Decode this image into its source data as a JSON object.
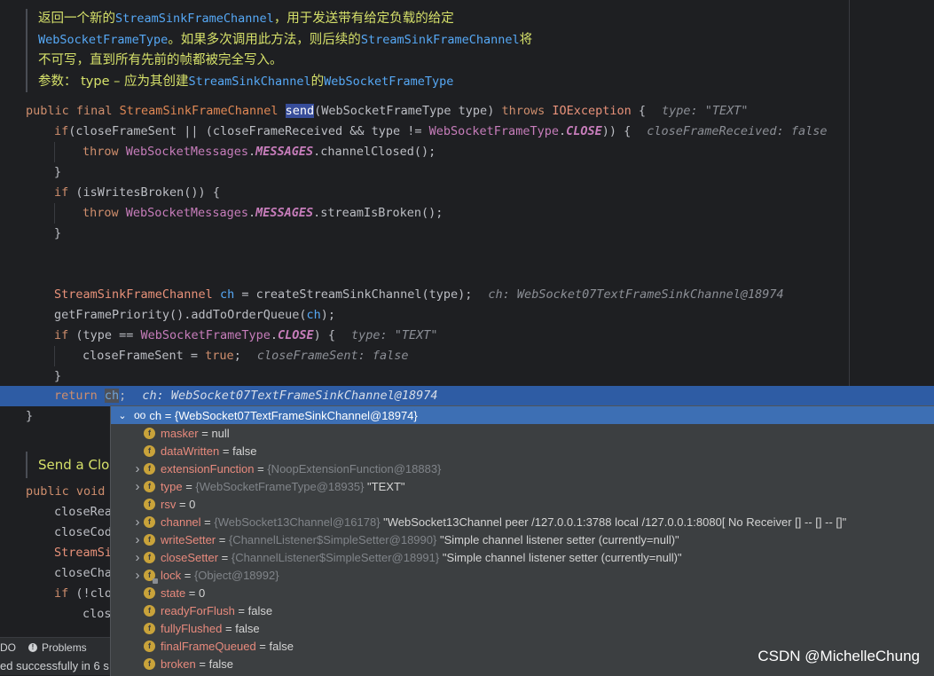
{
  "doc": {
    "l1_a": "返回一个新的",
    "l1_code": "StreamSinkFrameChannel",
    "l1_b": "，用于发送带有给定负载的给定",
    "l2_code": "WebSocketFrameType",
    "l2_a": "。如果多次调用此方法，则后续的",
    "l2_code2": "StreamSinkFrameChannel",
    "l2_b": "将",
    "l3": "不可写，直到所有先前的帧都被完全写入。",
    "l4_a": "参数：  type – 应为其创建",
    "l4_code": "StreamSinkChannel",
    "l4_b": "的",
    "l4_code2": "WebSocketFrameType"
  },
  "code": {
    "sig_public": "public final ",
    "sig_type": "StreamSinkFrameChannel ",
    "sig_name": "send",
    "sig_params": "(WebSocketFrameType type) ",
    "sig_throws": "throws ",
    "sig_exc": "IOException",
    "sig_brace": " {",
    "sig_hint": "type: \"TEXT\"",
    "if1_a": "if",
    "if1_b": "(closeFrameSent || (closeFrameReceived && type != ",
    "if1_enum": "WebSocketFrameType",
    "if1_dot": ".",
    "if1_const": "CLOSE",
    "if1_c": ")) {",
    "if1_hint": "closeFrameReceived: false",
    "throw1_kw": "throw ",
    "throw1_cls": "WebSocketMessages",
    "throw1_dot": ".",
    "throw1_const": "MESSAGES",
    "throw1_call": ".channelClosed();",
    "brace": "}",
    "if2_kw": "if ",
    "if2_rest": "(isWritesBroken()) {",
    "throw2_kw": "throw ",
    "throw2_cls": "WebSocketMessages",
    "throw2_dot": ".",
    "throw2_const": "MESSAGES",
    "throw2_call": ".streamIsBroken();",
    "decl_type": "StreamSinkFrameChannel ",
    "decl_var": "ch",
    "decl_rest": " = createStreamSinkChannel(type);",
    "decl_hint": "ch: WebSocket07TextFrameSinkChannel@18974",
    "prio_a": "getFramePriority().addToOrderQueue(",
    "prio_var": "ch",
    "prio_b": ");",
    "if3_kw": "if ",
    "if3_a": "(type == ",
    "if3_enum": "WebSocketFrameType",
    "if3_dot": ".",
    "if3_const": "CLOSE",
    "if3_b": ") {",
    "if3_hint": "type: \"TEXT\"",
    "close_a": "closeFrameSent = ",
    "close_true": "true",
    "close_b": ";",
    "close_hint": "closeFrameSent: false",
    "ret_kw": "return ",
    "ret_var": "ch",
    "ret_semi": ";",
    "ret_hint": "ch: WebSocket07TextFrameSinkChannel@18974",
    "end_brace": "}",
    "doc2": "Send a Clo",
    "pv_public": "public void",
    "pv_rest": "",
    "s1": "closeRea",
    "s2": "closeCod",
    "s3": "StreamSi",
    "s4": "closeCha",
    "s5_kw": "if",
    "s5_rest": " (!clo",
    "s6": "clos"
  },
  "popup": {
    "root_icon": "oo",
    "root_label": "ch = {WebSocket07TextFrameSinkChannel@18974}",
    "fields": [
      {
        "name": "masker",
        "ref": "",
        "value": "null",
        "expandable": false,
        "locked": false
      },
      {
        "name": "dataWritten",
        "ref": "",
        "value": "false",
        "expandable": false,
        "locked": false
      },
      {
        "name": "extensionFunction",
        "ref": "{NoopExtensionFunction@18883}",
        "value": "",
        "expandable": true,
        "locked": false
      },
      {
        "name": "type",
        "ref": "{WebSocketFrameType@18935}",
        "value": "\"TEXT\"",
        "expandable": true,
        "locked": false
      },
      {
        "name": "rsv",
        "ref": "",
        "value": "0",
        "expandable": false,
        "locked": false
      },
      {
        "name": "channel",
        "ref": "{WebSocket13Channel@16178}",
        "value": "\"WebSocket13Channel peer /127.0.0.1:3788 local /127.0.0.1:8080[ No Receiver [] -- [] -- []\"",
        "expandable": true,
        "locked": false
      },
      {
        "name": "writeSetter",
        "ref": "{ChannelListener$SimpleSetter@18990}",
        "value": "\"Simple channel listener setter (currently=null)\"",
        "expandable": true,
        "locked": false
      },
      {
        "name": "closeSetter",
        "ref": "{ChannelListener$SimpleSetter@18991}",
        "value": "\"Simple channel listener setter (currently=null)\"",
        "expandable": true,
        "locked": false
      },
      {
        "name": "lock",
        "ref": "{Object@18992}",
        "value": "",
        "expandable": true,
        "locked": true
      },
      {
        "name": "state",
        "ref": "",
        "value": "0",
        "expandable": false,
        "locked": false
      },
      {
        "name": "readyForFlush",
        "ref": "",
        "value": "false",
        "expandable": false,
        "locked": false
      },
      {
        "name": "fullyFlushed",
        "ref": "",
        "value": "false",
        "expandable": false,
        "locked": false
      },
      {
        "name": "finalFrameQueued",
        "ref": "",
        "value": "false",
        "expandable": false,
        "locked": false
      },
      {
        "name": "broken",
        "ref": "",
        "value": "false",
        "expandable": false,
        "locked": false
      }
    ]
  },
  "toolwin": {
    "todo": "DO",
    "problems": "Problems"
  },
  "status": {
    "message": "ed successfully in 6 s"
  },
  "watermark": "CSDN @MichelleChung",
  "colors": {
    "editor_bg": "#1e1f22",
    "exec_line": "#2e5ca4",
    "popup_bg": "#3c3f41",
    "popup_selected": "#3d6fb4",
    "doc_text": "#d6e16a",
    "keyword": "#cf8e6d",
    "field_name": "#e88a7d"
  }
}
